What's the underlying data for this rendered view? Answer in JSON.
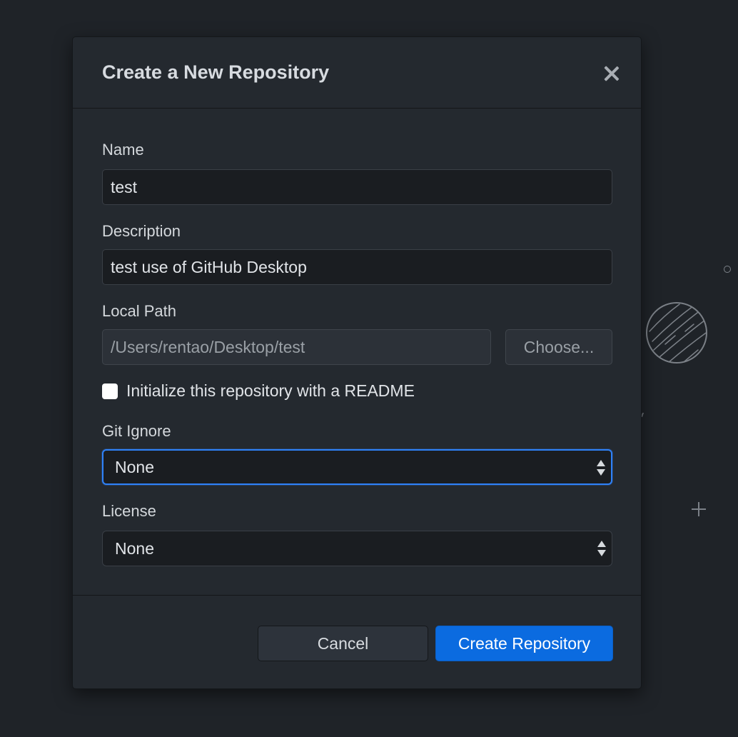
{
  "dialog": {
    "title": "Create a New Repository",
    "close_icon": "close-icon"
  },
  "form": {
    "name": {
      "label": "Name",
      "value": "test"
    },
    "description": {
      "label": "Description",
      "value": "test use of GitHub Desktop"
    },
    "local_path": {
      "label": "Local Path",
      "value": "/Users/rentao/Desktop/test",
      "choose_label": "Choose..."
    },
    "readme": {
      "label": "Initialize this repository with a README",
      "checked": false
    },
    "git_ignore": {
      "label": "Git Ignore",
      "selected": "None"
    },
    "license": {
      "label": "License",
      "selected": "None"
    }
  },
  "footer": {
    "cancel_label": "Cancel",
    "create_label": "Create Repository"
  },
  "colors": {
    "background": "#1f2328",
    "dialog": "#24292f",
    "primary": "#0b6be0",
    "focus": "#2f81f7"
  }
}
